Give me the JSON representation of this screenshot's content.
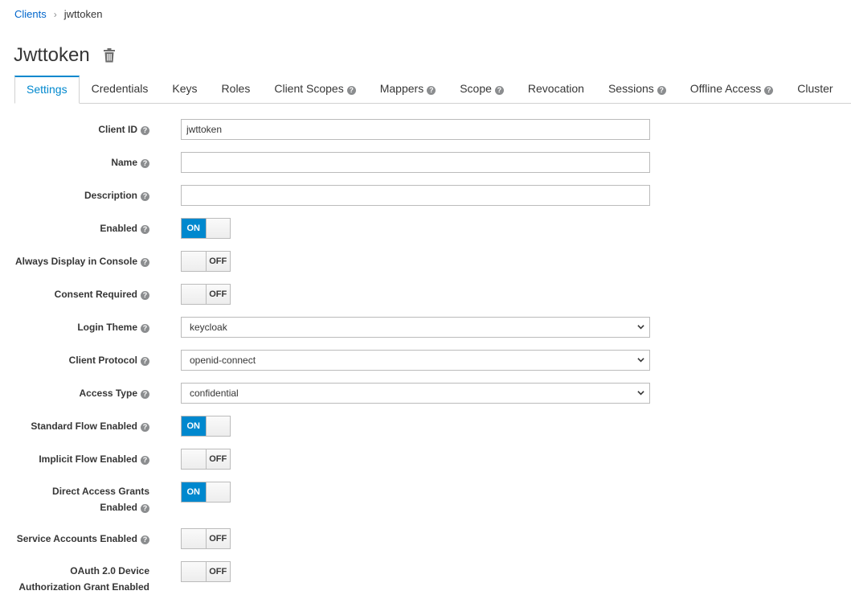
{
  "breadcrumb": {
    "parent": "Clients",
    "separator": "›",
    "current": "jwttoken"
  },
  "page": {
    "title": "Jwttoken"
  },
  "tabs": [
    {
      "label": "Settings",
      "help": false,
      "active": true
    },
    {
      "label": "Credentials",
      "help": false
    },
    {
      "label": "Keys",
      "help": false
    },
    {
      "label": "Roles",
      "help": false
    },
    {
      "label": "Client Scopes",
      "help": true
    },
    {
      "label": "Mappers",
      "help": true
    },
    {
      "label": "Scope",
      "help": true
    },
    {
      "label": "Revocation",
      "help": false
    },
    {
      "label": "Sessions",
      "help": true
    },
    {
      "label": "Offline Access",
      "help": true
    },
    {
      "label": "Cluster",
      "help": false
    }
  ],
  "help_glyph": "?",
  "form": {
    "client_id": {
      "label": "Client ID",
      "value": "jwttoken"
    },
    "name": {
      "label": "Name",
      "value": ""
    },
    "description": {
      "label": "Description",
      "value": ""
    },
    "enabled": {
      "label": "Enabled",
      "state": "ON"
    },
    "always_display": {
      "label": "Always Display in Console",
      "state": "OFF"
    },
    "consent_required": {
      "label": "Consent Required",
      "state": "OFF"
    },
    "login_theme": {
      "label": "Login Theme",
      "value": "keycloak"
    },
    "client_protocol": {
      "label": "Client Protocol",
      "value": "openid-connect"
    },
    "access_type": {
      "label": "Access Type",
      "value": "confidential"
    },
    "standard_flow": {
      "label": "Standard Flow Enabled",
      "state": "ON"
    },
    "implicit_flow": {
      "label": "Implicit Flow Enabled",
      "state": "OFF"
    },
    "direct_access": {
      "label_line1": "Direct Access Grants",
      "label_line2": "Enabled",
      "state": "ON"
    },
    "service_accounts": {
      "label": "Service Accounts Enabled",
      "state": "OFF"
    },
    "oauth_device": {
      "label_line1": "OAuth 2.0 Device",
      "label_line2": "Authorization Grant Enabled",
      "state": "OFF"
    }
  },
  "colors": {
    "accent": "#0088ce",
    "link": "#0066cc",
    "text": "#363636",
    "border": "#bbbbbb"
  }
}
